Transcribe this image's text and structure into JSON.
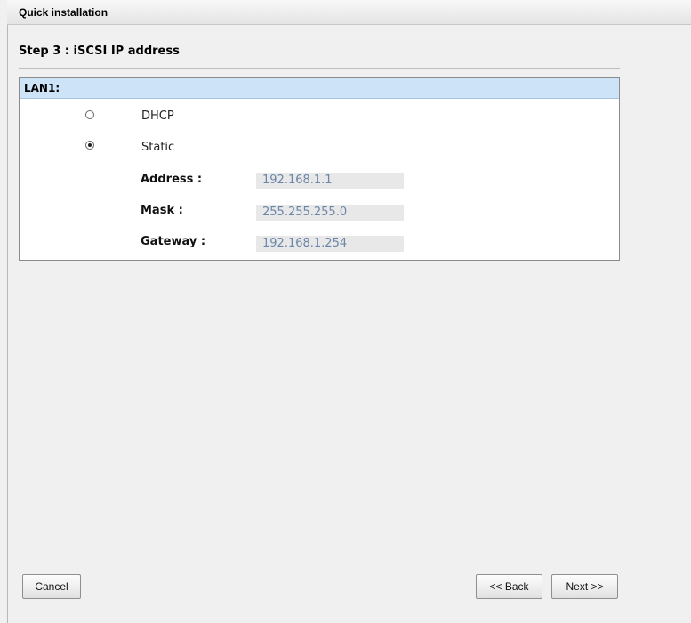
{
  "window": {
    "title": "Quick installation"
  },
  "step": {
    "title": "Step 3 : iSCSI IP address"
  },
  "panel": {
    "title": "LAN1:",
    "options": [
      {
        "label": "DHCP",
        "selected": false
      },
      {
        "label": "Static",
        "selected": true
      }
    ],
    "fields": [
      {
        "label": "Address :",
        "value": "192.168.1.1"
      },
      {
        "label": "Mask :",
        "value": "255.255.255.0"
      },
      {
        "label": "Gateway :",
        "value": "192.168.1.254"
      }
    ]
  },
  "footer": {
    "cancel_label": "Cancel",
    "back_label": "<< Back",
    "next_label": "Next >>"
  },
  "colors": {
    "header_bg": "#cde3f7",
    "field_text": "#6b86a8",
    "field_bg": "#e8e8e8"
  }
}
